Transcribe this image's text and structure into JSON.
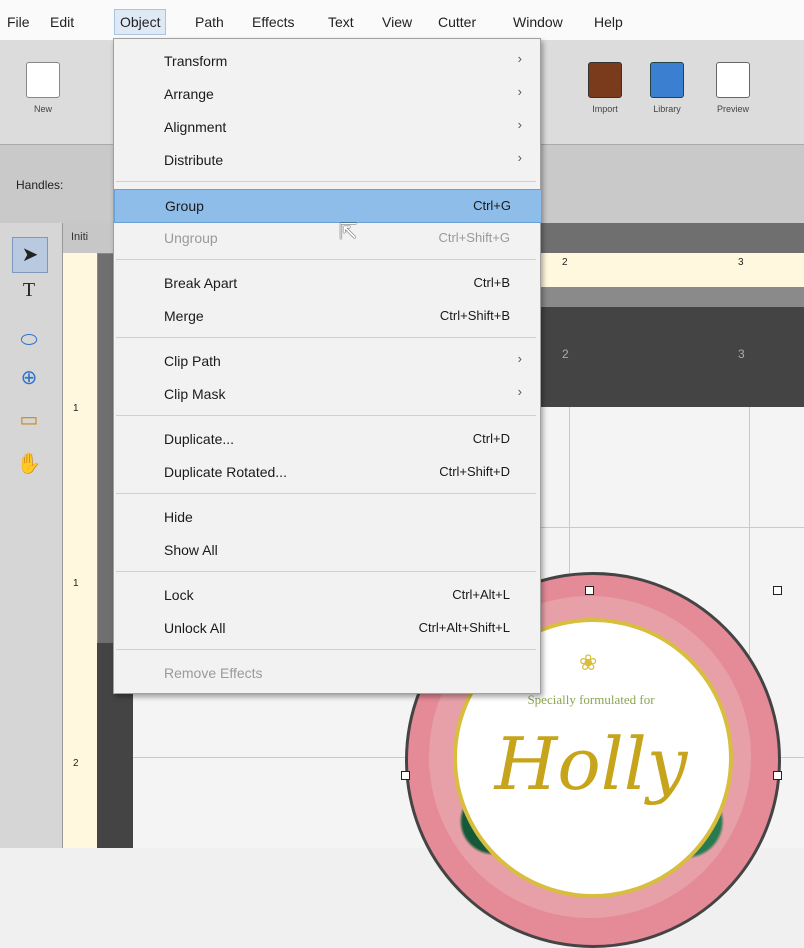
{
  "menubar": {
    "items": [
      {
        "label": "File"
      },
      {
        "label": "Edit"
      },
      {
        "label": "Object"
      },
      {
        "label": "Path"
      },
      {
        "label": "Effects"
      },
      {
        "label": "Text"
      },
      {
        "label": "View"
      },
      {
        "label": "Cutter"
      },
      {
        "label": "Window"
      },
      {
        "label": "Help"
      }
    ]
  },
  "toolbar": {
    "buttons": [
      {
        "label": "New",
        "icon": "new-document-icon"
      },
      {
        "label": "Import",
        "icon": "import-svg-icon"
      },
      {
        "label": "Library",
        "icon": "library-icon"
      },
      {
        "label": "Preview",
        "icon": "preview-magnifier-icon"
      }
    ]
  },
  "propbar": {
    "handles_label": "Handles:"
  },
  "doc": {
    "tab_label": "Initi"
  },
  "rulers": {
    "h_ticks": [
      "2",
      "3"
    ],
    "v_ticks": [
      "1",
      "1",
      "2"
    ],
    "mat_ticks": [
      "2",
      "3"
    ]
  },
  "menu": {
    "items": [
      {
        "label": "Transform",
        "submenu": true
      },
      {
        "label": "Arrange",
        "submenu": true
      },
      {
        "label": "Alignment",
        "submenu": true
      },
      {
        "label": "Distribute",
        "submenu": true
      },
      {
        "label": "Group",
        "shortcut": "Ctrl+G",
        "highlighted": true
      },
      {
        "label": "Ungroup",
        "shortcut": "Ctrl+Shift+G",
        "disabled": true
      },
      {
        "label": "Break Apart",
        "shortcut": "Ctrl+B"
      },
      {
        "label": "Merge",
        "shortcut": "Ctrl+Shift+B"
      },
      {
        "label": "Clip Path",
        "submenu": true
      },
      {
        "label": "Clip Mask",
        "submenu": true
      },
      {
        "label": "Duplicate...",
        "shortcut": "Ctrl+D"
      },
      {
        "label": "Duplicate Rotated...",
        "shortcut": "Ctrl+Shift+D"
      },
      {
        "label": "Hide"
      },
      {
        "label": "Show All"
      },
      {
        "label": "Lock",
        "shortcut": "Ctrl+Alt+L"
      },
      {
        "label": "Unlock All",
        "shortcut": "Ctrl+Alt+Shift+L"
      },
      {
        "label": "Remove Effects",
        "disabled": true
      }
    ],
    "submenu_glyph": "›"
  },
  "design": {
    "subtitle": "Specially formulated for",
    "name": "Holly",
    "flower": "❀"
  },
  "colors": {
    "highlight": "#8fbde9",
    "label_ring": "#e58b97",
    "gold": "#c6a41c",
    "leaf_green": "#1f6b46"
  }
}
